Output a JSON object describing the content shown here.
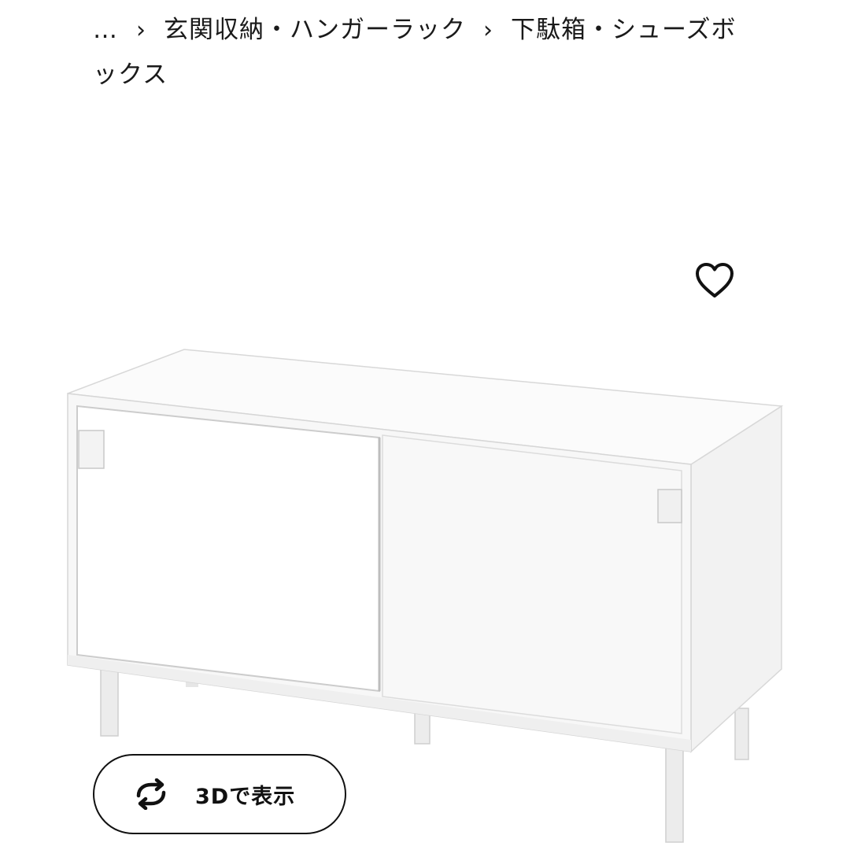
{
  "breadcrumb": {
    "items": [
      {
        "label": "…"
      },
      {
        "label": "玄関収納・ハンガーラック"
      },
      {
        "label": "下駄箱・シューズボックス"
      }
    ],
    "separator": "›"
  },
  "favorite": {
    "icon": "heart-outline-icon"
  },
  "product_image": {
    "alt": "white sideboard with sliding doors"
  },
  "view_3d": {
    "icon": "rotate-arrows-icon",
    "label": "3Dで表示"
  },
  "colors": {
    "text": "#111111",
    "background": "#ffffff"
  }
}
